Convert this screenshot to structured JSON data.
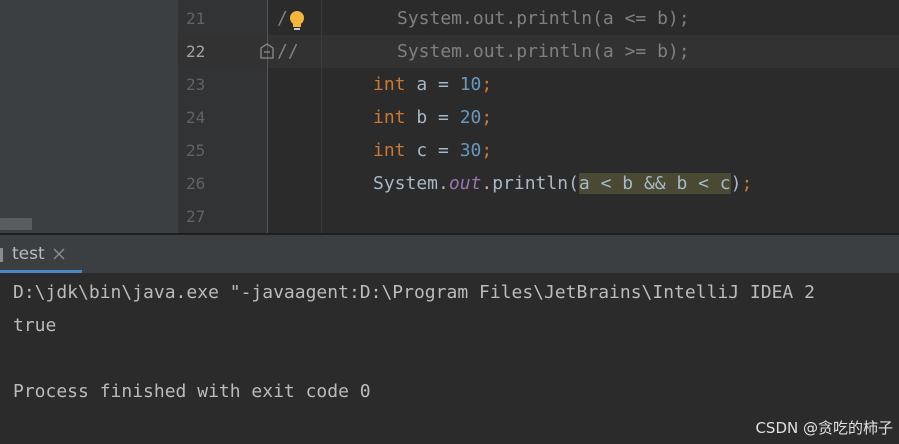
{
  "editor": {
    "line_numbers": [
      "21",
      "22",
      "23",
      "24",
      "25",
      "26",
      "27"
    ],
    "lines": {
      "l21": {
        "slash": "/",
        "code": "System.out.println(a <= b);"
      },
      "l22": {
        "slash": "//",
        "code": "System.out.println(a >= b);"
      },
      "l23": {
        "kw": "int",
        "name": " a = ",
        "num": "10",
        "end": ";"
      },
      "l24": {
        "kw": "int",
        "name": " b = ",
        "num": "20",
        "end": ";"
      },
      "l25": {
        "kw": "int",
        "name": " c = ",
        "num": "30",
        "end": ";"
      },
      "l26": {
        "cls": "System.",
        "field": "out",
        "method": ".println(",
        "selection": "a < b && b < c",
        "close": ")",
        "end": ";"
      }
    },
    "icons": [
      "lightbulb-icon",
      "fold-marker-icon"
    ]
  },
  "run_window": {
    "tab_label": "test",
    "console": [
      "D:\\jdk\\bin\\java.exe \"-javaagent:D:\\Program Files\\JetBrains\\IntelliJ IDEA 2",
      "true",
      "",
      "Process finished with exit code 0"
    ]
  },
  "watermark": "CSDN @贪吃的柿子",
  "colors": {
    "background": "#2b2b2b",
    "keyword": "#cc7832",
    "number": "#6897bb",
    "comment": "#808080",
    "field": "#9876aa",
    "text": "#a9b7c6",
    "selection": "#4a4a34"
  }
}
